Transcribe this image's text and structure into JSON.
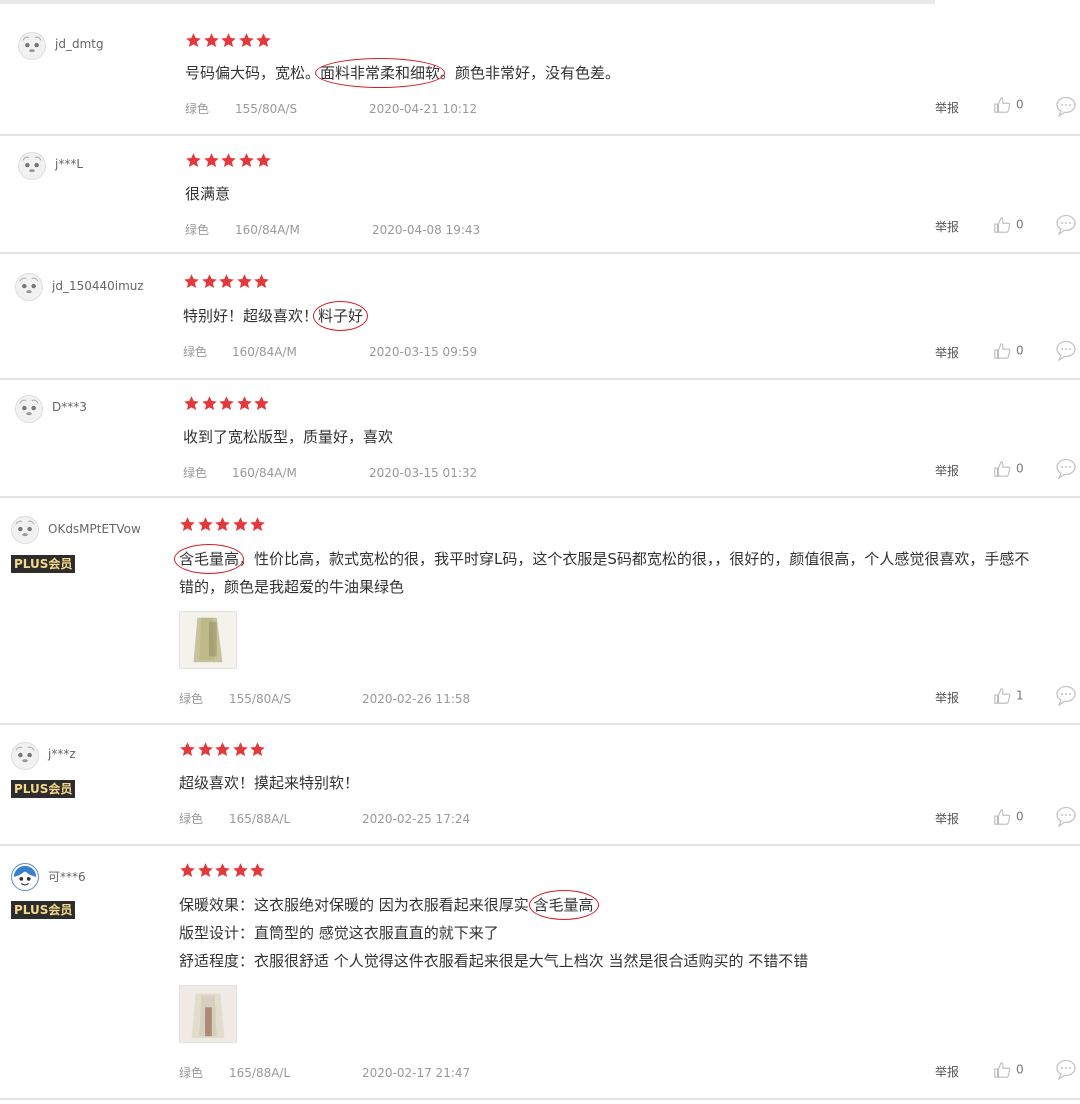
{
  "plus_badge": "PLUS会员",
  "report_label": "举报",
  "colors": {
    "star": "#e4393c",
    "highlight_circle": "#d41f2a",
    "plus_bg": "#2d2d2d",
    "plus_text": "#f5d88a"
  },
  "reviews": [
    {
      "username": "jd_dmtg",
      "plus": false,
      "rating": 5,
      "content_parts": [
        "号码偏大码，宽松。",
        "面料非常柔和细软",
        "。颜色非常好，没有色差。"
      ],
      "color": "绿色",
      "size": "155/80A/S",
      "datetime": "2020-04-21 10:12",
      "likes": "0"
    },
    {
      "username": "j***L",
      "plus": false,
      "rating": 5,
      "content_parts": [
        "很满意"
      ],
      "color": "绿色",
      "size": "160/84A/M",
      "datetime": "2020-04-08 19:43",
      "likes": "0"
    },
    {
      "username": "jd_150440imuz",
      "plus": false,
      "rating": 5,
      "content_parts": [
        "特别好！超级喜欢！",
        "料子好"
      ],
      "color": "绿色",
      "size": "160/84A/M",
      "datetime": "2020-03-15 09:59",
      "likes": "0"
    },
    {
      "username": "D***3",
      "plus": false,
      "rating": 5,
      "content_parts": [
        "收到了宽松版型，质量好，喜欢"
      ],
      "color": "绿色",
      "size": "160/84A/M",
      "datetime": "2020-03-15 01:32",
      "likes": "0"
    },
    {
      "username": "OKdsMPtETVow",
      "plus": true,
      "rating": 5,
      "content_parts": [
        "含毛量高",
        "，性价比高，款式宽松的很，我平时穿L码，这个衣服是S码都宽松的很，，很好的，颜值很高，个人感觉很喜欢，手感不",
        "错的，颜色是我超爱的牛油果绿色"
      ],
      "color": "绿色",
      "size": "155/80A/S",
      "datetime": "2020-02-26 11:58",
      "likes": "1"
    },
    {
      "username": "j***z",
      "plus": true,
      "rating": 5,
      "content_parts": [
        "超级喜欢！摸起来特别软！"
      ],
      "color": "绿色",
      "size": "165/88A/L",
      "datetime": "2020-02-25 17:24",
      "likes": "0"
    },
    {
      "username": "可***6",
      "plus": true,
      "rating": 5,
      "content_parts": [
        "保暖效果：这衣服绝对保暖的 因为衣服看起来很厚实 ",
        "含毛量高",
        "版型设计：直筒型的 感觉这衣服直直的就下来了",
        "舒适程度：衣服很舒适 个人觉得这件衣服看起来很是大气上档次 当然是很合适购买的 不错不错"
      ],
      "color": "绿色",
      "size": "165/88A/L",
      "datetime": "2020-02-17 21:47",
      "likes": "0"
    }
  ]
}
